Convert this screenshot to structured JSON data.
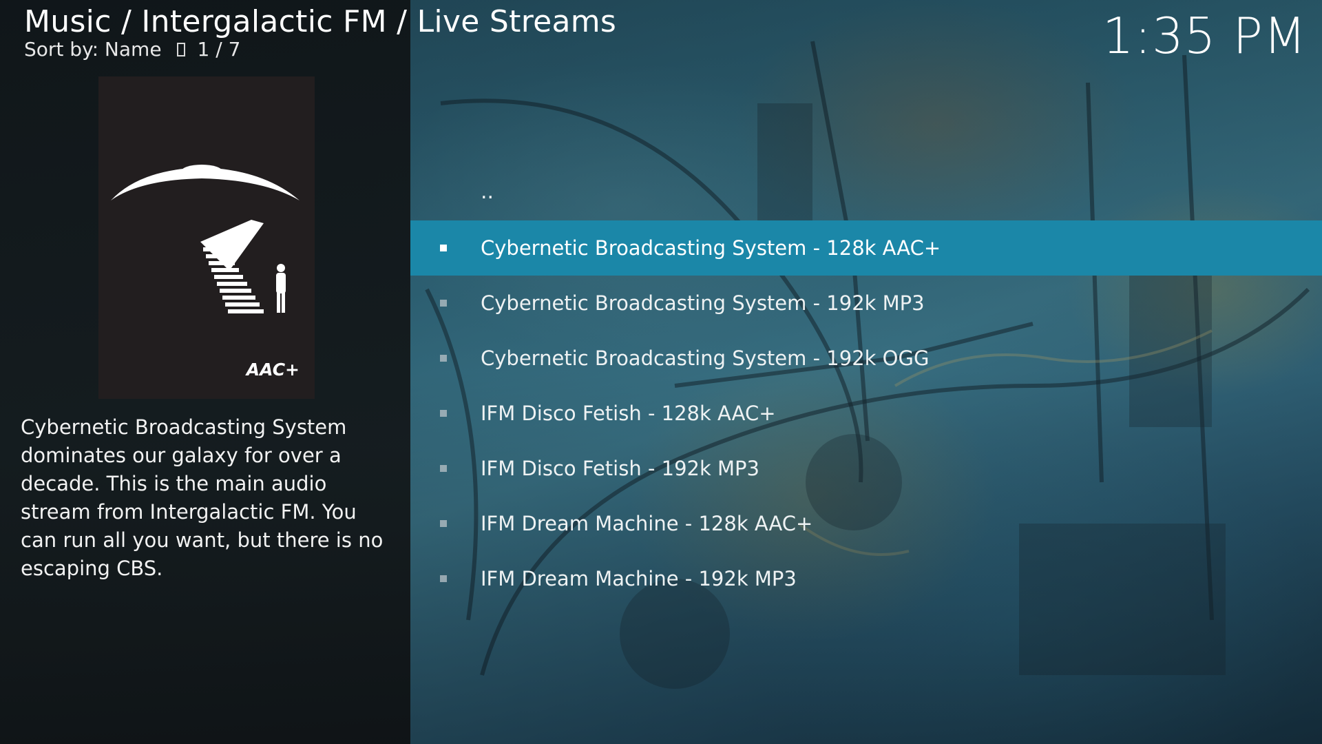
{
  "header": {
    "breadcrumb": "Music / Intergalactic FM / Live Streams",
    "sort_label": "Sort by: Name",
    "sort_icon": "sort-order-icon",
    "position": "1 / 7"
  },
  "clock": "1:35 PM",
  "cover": {
    "badge": "AAC+"
  },
  "plot": "Cybernetic Broadcasting System dominates our galaxy for over a decade. This is the main audio stream from Intergalactic FM. You can run all you want, but there is no escaping CBS.",
  "list": {
    "parent_item": "..",
    "items": [
      {
        "label": "Cybernetic Broadcasting System - 128k AAC+"
      },
      {
        "label": "Cybernetic Broadcasting System - 192k MP3"
      },
      {
        "label": "Cybernetic Broadcasting System - 192k OGG"
      },
      {
        "label": "IFM Disco Fetish - 128k AAC+"
      },
      {
        "label": "IFM Disco Fetish - 192k MP3"
      },
      {
        "label": "IFM Dream Machine - 128k AAC+"
      },
      {
        "label": "IFM Dream Machine - 192k MP3"
      }
    ],
    "focused_index": 0
  },
  "colors": {
    "focus": "#1b87a8",
    "panel": "#121618"
  }
}
